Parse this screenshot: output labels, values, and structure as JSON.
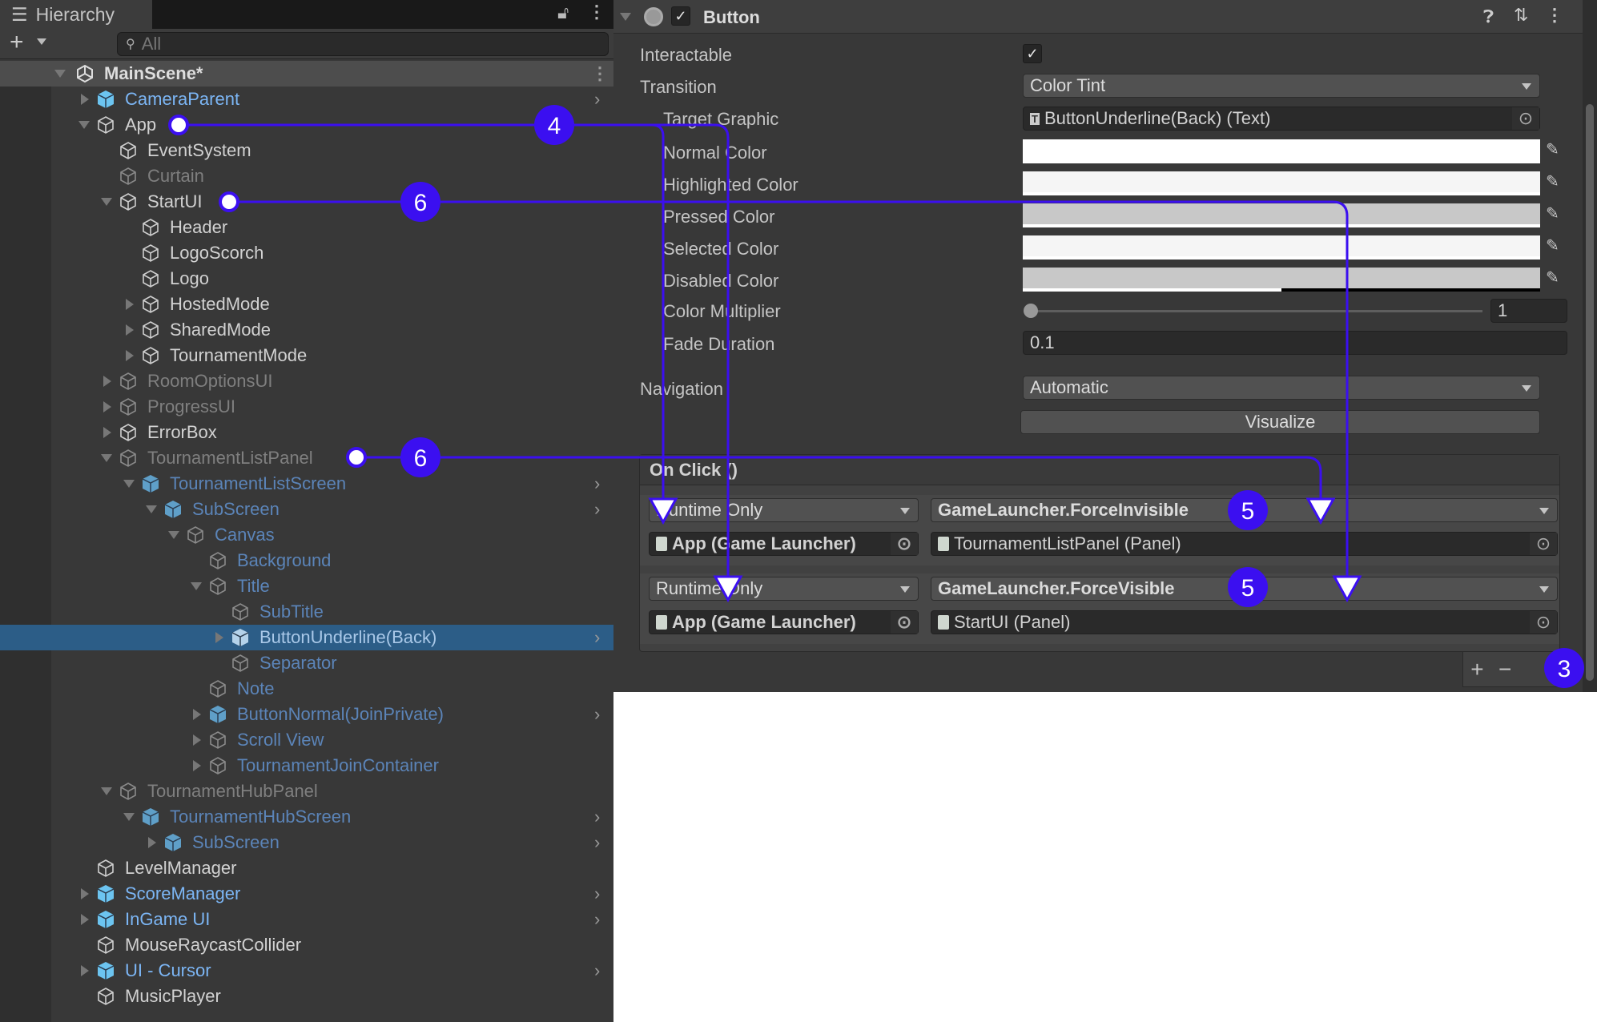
{
  "hierarchy": {
    "tab_label": "Hierarchy",
    "search_placeholder": "All",
    "scene_name": "MainScene*",
    "rows": [
      {
        "name": "CameraParent",
        "depth": 1,
        "state": "collapsed",
        "kind": "prefab",
        "style": "prefab",
        "chevron": true
      },
      {
        "name": "App",
        "depth": 1,
        "state": "expanded",
        "kind": "object",
        "style": "normal"
      },
      {
        "name": "EventSystem",
        "depth": 2,
        "state": "none",
        "kind": "object",
        "style": "normal"
      },
      {
        "name": "Curtain",
        "depth": 2,
        "state": "none",
        "kind": "object",
        "style": "inactive"
      },
      {
        "name": "StartUI",
        "depth": 2,
        "state": "expanded",
        "kind": "object",
        "style": "normal"
      },
      {
        "name": "Header",
        "depth": 3,
        "state": "none",
        "kind": "object",
        "style": "normal"
      },
      {
        "name": "LogoScorch",
        "depth": 3,
        "state": "none",
        "kind": "object",
        "style": "normal"
      },
      {
        "name": "Logo",
        "depth": 3,
        "state": "none",
        "kind": "object",
        "style": "normal"
      },
      {
        "name": "HostedMode",
        "depth": 3,
        "state": "collapsed",
        "kind": "object",
        "style": "normal"
      },
      {
        "name": "SharedMode",
        "depth": 3,
        "state": "collapsed",
        "kind": "object",
        "style": "normal"
      },
      {
        "name": "TournamentMode",
        "depth": 3,
        "state": "collapsed",
        "kind": "object",
        "style": "normal"
      },
      {
        "name": "RoomOptionsUI",
        "depth": 2,
        "state": "collapsed",
        "kind": "object",
        "style": "inactive"
      },
      {
        "name": "ProgressUI",
        "depth": 2,
        "state": "collapsed",
        "kind": "object",
        "style": "inactive"
      },
      {
        "name": "ErrorBox",
        "depth": 2,
        "state": "collapsed",
        "kind": "object",
        "style": "normal"
      },
      {
        "name": "TournamentListPanel",
        "depth": 2,
        "state": "expanded",
        "kind": "object",
        "style": "inactive"
      },
      {
        "name": "TournamentListScreen",
        "depth": 3,
        "state": "expanded",
        "kind": "prefab",
        "style": "prefab-inactive",
        "chevron": true
      },
      {
        "name": "SubScreen",
        "depth": 4,
        "state": "expanded",
        "kind": "prefab",
        "style": "prefab-inactive",
        "chevron": true
      },
      {
        "name": "Canvas",
        "depth": 5,
        "state": "expanded",
        "kind": "object",
        "style": "prefab-inactive"
      },
      {
        "name": "Background",
        "depth": 6,
        "state": "none",
        "kind": "object",
        "style": "prefab-inactive"
      },
      {
        "name": "Title",
        "depth": 6,
        "state": "expanded",
        "kind": "object",
        "style": "prefab-inactive"
      },
      {
        "name": "SubTitle",
        "depth": 7,
        "state": "none",
        "kind": "object",
        "style": "prefab-inactive"
      },
      {
        "name": "ButtonUnderline(Back)",
        "depth": 7,
        "state": "collapsed",
        "kind": "prefab",
        "style": "selected",
        "chevron": true,
        "selected": true
      },
      {
        "name": "Separator",
        "depth": 7,
        "state": "none",
        "kind": "object",
        "style": "prefab-inactive"
      },
      {
        "name": "Note",
        "depth": 6,
        "state": "none",
        "kind": "object",
        "style": "prefab-inactive"
      },
      {
        "name": "ButtonNormal(JoinPrivate)",
        "depth": 6,
        "state": "collapsed",
        "kind": "prefab",
        "style": "prefab-inactive",
        "chevron": true
      },
      {
        "name": "Scroll View",
        "depth": 6,
        "state": "collapsed",
        "kind": "object",
        "style": "prefab-inactive"
      },
      {
        "name": "TournamentJoinContainer",
        "depth": 6,
        "state": "collapsed",
        "kind": "object",
        "style": "prefab-inactive"
      },
      {
        "name": "TournamentHubPanel",
        "depth": 2,
        "state": "expanded",
        "kind": "object",
        "style": "inactive"
      },
      {
        "name": "TournamentHubScreen",
        "depth": 3,
        "state": "expanded",
        "kind": "prefab",
        "style": "prefab-inactive",
        "chevron": true
      },
      {
        "name": "SubScreen",
        "depth": 4,
        "state": "collapsed",
        "kind": "prefab",
        "style": "prefab-inactive",
        "chevron": true
      },
      {
        "name": "LevelManager",
        "depth": 1,
        "state": "none",
        "kind": "object",
        "style": "normal"
      },
      {
        "name": "ScoreManager",
        "depth": 1,
        "state": "collapsed",
        "kind": "prefab",
        "style": "prefab",
        "chevron": true
      },
      {
        "name": "InGame UI",
        "depth": 1,
        "state": "collapsed",
        "kind": "prefab",
        "style": "prefab",
        "chevron": true
      },
      {
        "name": "MouseRaycastCollider",
        "depth": 1,
        "state": "none",
        "kind": "object",
        "style": "normal"
      },
      {
        "name": "UI - Cursor",
        "depth": 1,
        "state": "collapsed",
        "kind": "prefab",
        "style": "prefab",
        "chevron": true
      },
      {
        "name": "MusicPlayer",
        "depth": 1,
        "state": "none",
        "kind": "object",
        "style": "normal"
      }
    ]
  },
  "inspector": {
    "component_title": "Button",
    "component_enabled": true,
    "interactable": {
      "label": "Interactable",
      "checked": true
    },
    "transition": {
      "label": "Transition",
      "value": "Color Tint"
    },
    "target_graphic": {
      "label": "Target Graphic",
      "value": "ButtonUnderline(Back) (Text)"
    },
    "colors": [
      {
        "label": "Normal Color",
        "color": "#ffffff",
        "alpha": 1
      },
      {
        "label": "Highlighted Color",
        "color": "#f5f5f5",
        "alpha": 1
      },
      {
        "label": "Pressed Color",
        "color": "#c8c8c8",
        "alpha": 1
      },
      {
        "label": "Selected Color",
        "color": "#f5f5f5",
        "alpha": 1
      },
      {
        "label": "Disabled Color",
        "color": "#c8c8c8",
        "alpha": 0.5
      }
    ],
    "color_multiplier": {
      "label": "Color Multiplier",
      "value": "1",
      "slider_fraction": 0
    },
    "fade_duration": {
      "label": "Fade Duration",
      "value": "0.1"
    },
    "navigation": {
      "label": "Navigation",
      "value": "Automatic"
    },
    "visualize_label": "Visualize",
    "on_click": {
      "title": "On Click ()",
      "entries": [
        {
          "runtime": "Runtime Only",
          "function": "GameLauncher.ForceInvisible",
          "target": "App (Game Launcher)",
          "argument": "TournamentListPanel (Panel)"
        },
        {
          "runtime": "Runtime Only",
          "function": "GameLauncher.ForceVisible",
          "target": "App (Game Launcher)",
          "argument": "StartUI (Panel)"
        }
      ],
      "add_label": "+",
      "remove_label": "−"
    }
  },
  "annotations": {
    "color": "#3b0ff0",
    "badges": [
      "4",
      "6",
      "6",
      "5",
      "5",
      "3"
    ]
  }
}
